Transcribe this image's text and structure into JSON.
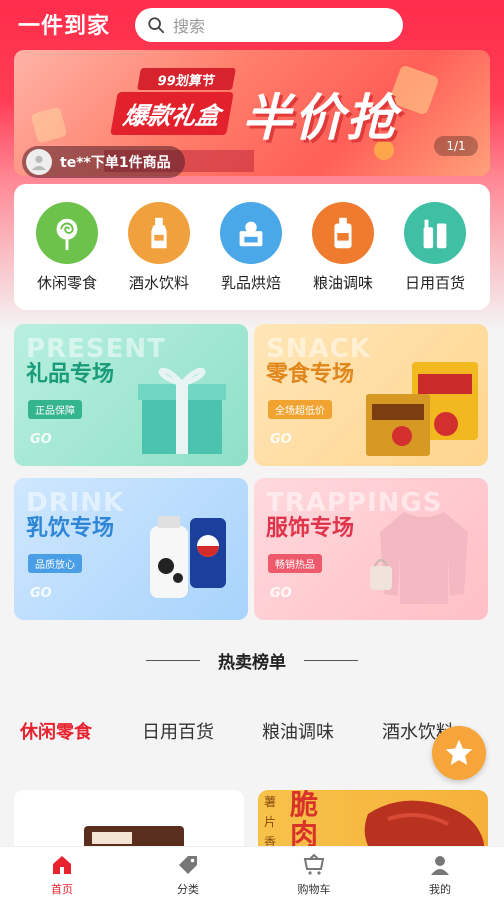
{
  "header": {
    "app_title": "一件到家",
    "search_placeholder": "搜索"
  },
  "banner": {
    "tag": "99划算节",
    "subtitle": "爆款礼盒",
    "headline": "半价抢",
    "counter": "1/1",
    "order_ticker": "te**下单1件商品"
  },
  "categories": [
    {
      "label": "休闲零食",
      "icon": "lollipop-icon",
      "color": "#6cc24a"
    },
    {
      "label": "酒水饮料",
      "icon": "bottle-icon",
      "color": "#f0a03c"
    },
    {
      "label": "乳品烘焙",
      "icon": "bakery-icon",
      "color": "#4aa8e8"
    },
    {
      "label": "粮油调味",
      "icon": "oil-icon",
      "color": "#ef7c2e"
    },
    {
      "label": "日用百货",
      "icon": "toiletries-icon",
      "color": "#3fbfa4"
    }
  ],
  "zones": {
    "gift": {
      "watermark": "PRESENT",
      "title": "礼品专场",
      "badge": "正品保障",
      "go": "GO",
      "title_color": "#1a9b7a",
      "badge_color": "#35b58e"
    },
    "snack": {
      "watermark": "SNACK",
      "title": "零食专场",
      "badge": "全场超低价",
      "go": "GO",
      "title_color": "#e0861a",
      "badge_color": "#f0a331"
    },
    "drink": {
      "watermark": "DRINK",
      "title": "乳饮专场",
      "badge": "品质放心",
      "go": "GO",
      "title_color": "#2f86d6",
      "badge_color": "#4a9ee6"
    },
    "apparel": {
      "watermark": "TRAPPINGS",
      "title": "服饰专场",
      "badge": "畅销热品",
      "go": "GO",
      "title_color": "#e0344b",
      "badge_color": "#ee5a6b"
    }
  },
  "hot": {
    "title": "热卖榜单",
    "tabs": [
      "休闲零食",
      "日用百货",
      "粮油调味",
      "酒水饮料"
    ]
  },
  "product_preview": {
    "right_side_text": [
      "薯",
      "片",
      "香"
    ],
    "right_big_text": [
      "脆",
      "肉"
    ]
  },
  "nav": [
    {
      "label": "首页",
      "icon": "home-icon",
      "active": true
    },
    {
      "label": "分类",
      "icon": "tag-icon",
      "active": false
    },
    {
      "label": "购物车",
      "icon": "cart-icon",
      "active": false
    },
    {
      "label": "我的",
      "icon": "user-icon",
      "active": false
    }
  ],
  "colors": {
    "brand_red": "#ff2d4b",
    "active_red": "#e8232f",
    "float_button": "#f7a43a"
  }
}
